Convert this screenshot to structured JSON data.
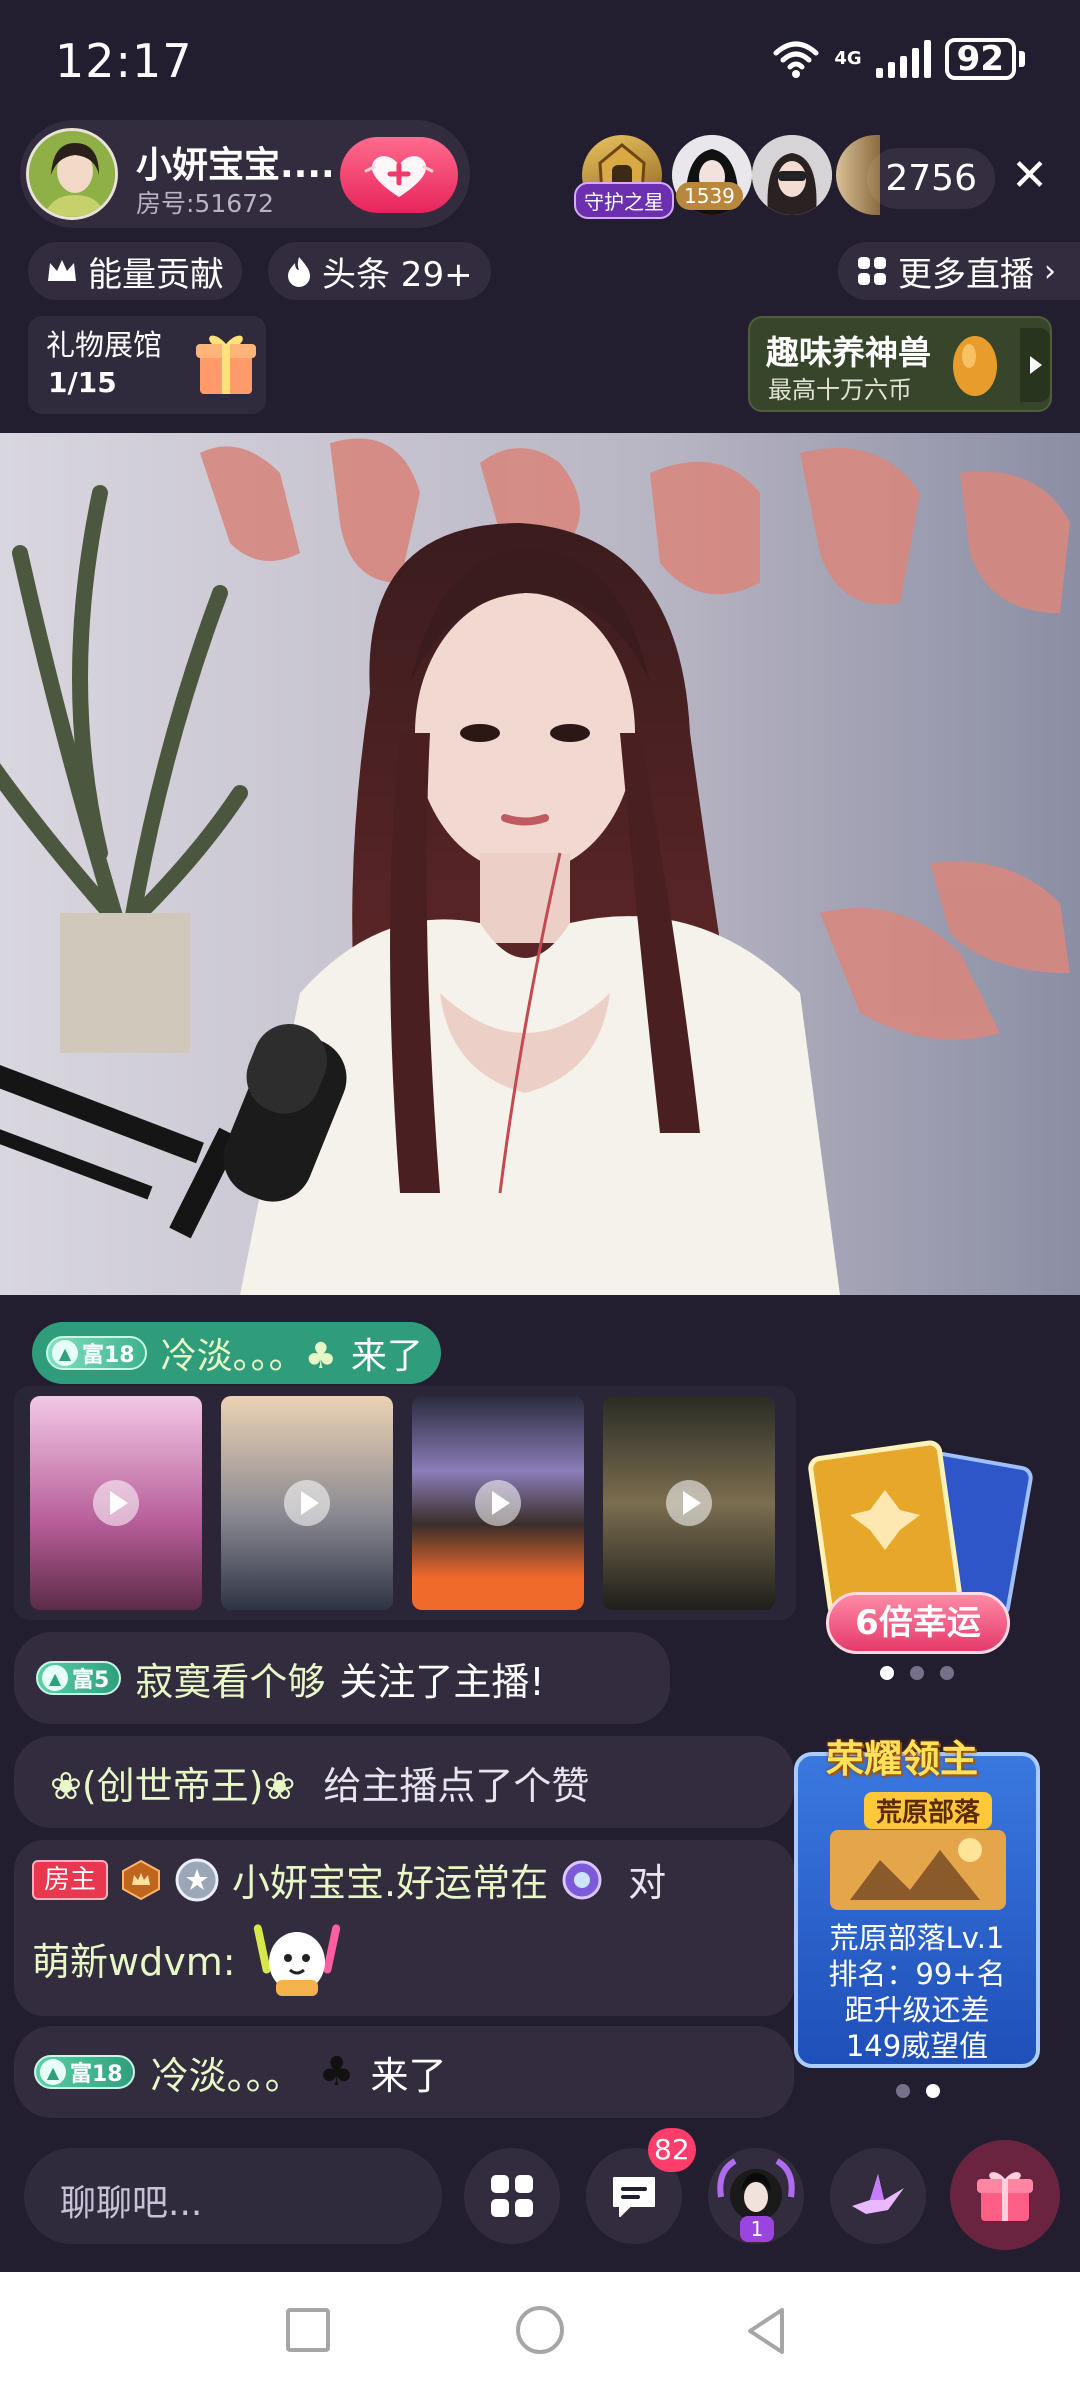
{
  "status": {
    "time": "12:17",
    "network": "4G",
    "battery": "92"
  },
  "host": {
    "name": "小妍宝宝....",
    "room": "房号:51672"
  },
  "viewers": {
    "badge_guard": "守护之星",
    "badge_1539": "1539",
    "count": "2756"
  },
  "top_chips": {
    "energy": "能量贡献",
    "headline": "头条 29+",
    "more_live": "更多直播"
  },
  "gift_hall": {
    "title": "礼物展馆",
    "progress": "1/15"
  },
  "game_banner": {
    "title": "趣味养神兽",
    "subtitle": "最高十万六币"
  },
  "chat": {
    "entry1": {
      "level": "富18",
      "user": "冷淡。。。♣",
      "action": "来了"
    },
    "entry2": {
      "level": "富5",
      "user": "寂寞看个够",
      "action": "关注了主播!"
    },
    "entry3": {
      "user": "(创世帝王)",
      "action": "给主播点了个赞"
    },
    "entry4": {
      "role": "房主",
      "user": "小妍宝宝.好运常在",
      "to": "对",
      "target": "萌新wdvm:"
    },
    "entry5": {
      "level": "富18",
      "user": "冷淡。。。",
      "action": "来了"
    }
  },
  "lucky": {
    "label": "6倍幸运"
  },
  "rank_card": {
    "title": "荣耀领主",
    "tribe_banner": "荒原部落",
    "level_text": "荒原部落Lv.1",
    "rank": "排名：99+名",
    "upgrade": "距升级还差",
    "gap": "149威望值"
  },
  "bottom": {
    "input_placeholder": "聊聊吧...",
    "chat_badge": "82",
    "avatar_badge": "1"
  },
  "colors": {
    "bg": "#231d30",
    "accent_pink": "#e8245c",
    "level_green": "#2f9f7c"
  }
}
